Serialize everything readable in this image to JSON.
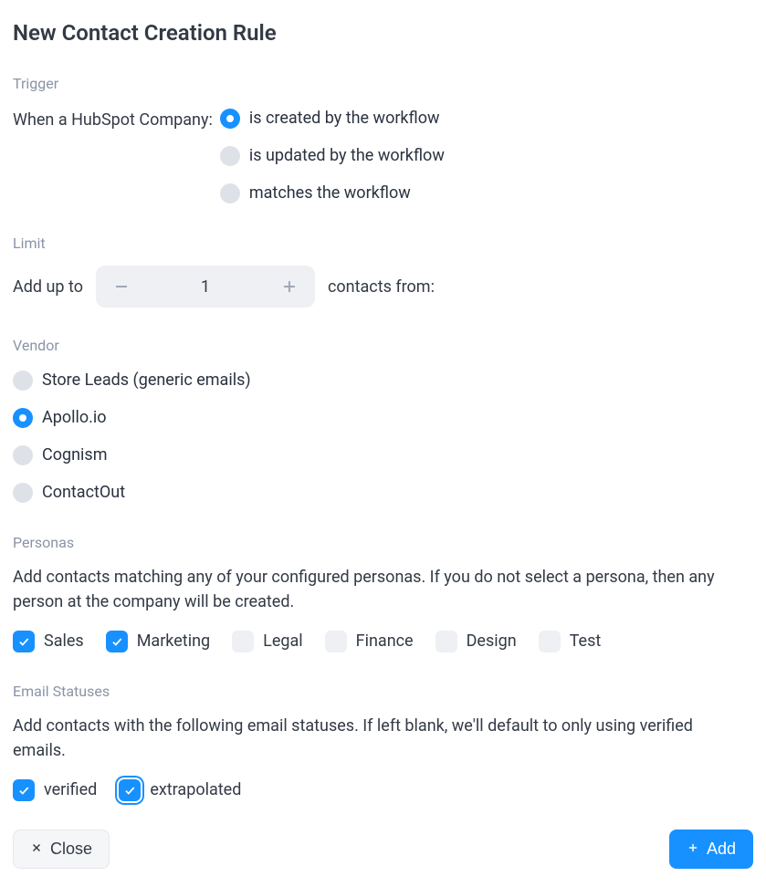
{
  "title": "New Contact Creation Rule",
  "trigger": {
    "label": "Trigger",
    "prompt": "When a HubSpot Company:",
    "options": {
      "created": "is created by the workflow",
      "updated": "is updated by the workflow",
      "matches": "matches the workflow"
    },
    "selected": "created"
  },
  "limit": {
    "label": "Limit",
    "prefix": "Add up to",
    "value": "1",
    "suffix": "contacts from:"
  },
  "vendor": {
    "label": "Vendor",
    "options": {
      "store_leads": "Store Leads (generic emails)",
      "apollo": "Apollo.io",
      "cognism": "Cognism",
      "contactout": "ContactOut"
    },
    "selected": "apollo"
  },
  "personas": {
    "label": "Personas",
    "description": "Add contacts matching any of your configured personas. If you do not select a persona, then any person at the company will be created.",
    "options": {
      "sales": "Sales",
      "marketing": "Marketing",
      "legal": "Legal",
      "finance": "Finance",
      "design": "Design",
      "test": "Test"
    },
    "checked": [
      "sales",
      "marketing"
    ]
  },
  "email_statuses": {
    "label": "Email Statuses",
    "description": "Add contacts with the following email statuses. If left blank, we'll default to only using verified emails.",
    "options": {
      "verified": "verified",
      "extrapolated": "extrapolated"
    },
    "checked": [
      "verified",
      "extrapolated"
    ],
    "focused": "extrapolated"
  },
  "footer": {
    "close": "Close",
    "add": "Add"
  }
}
